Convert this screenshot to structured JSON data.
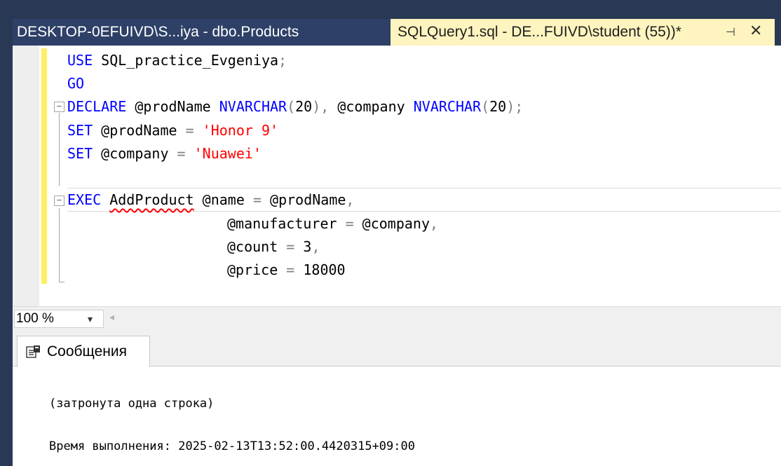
{
  "tabs": {
    "products_title": "DESKTOP-0EFUIVD\\S...iya - dbo.Products",
    "query_title": "SQLQuery1.sql - DE...FUIVD\\student (55))*",
    "pin_glyph": "⊣",
    "close_glyph": "✕"
  },
  "editor": {
    "fold_expanded_glyph": "−",
    "lines": {
      "l1_kw": "USE",
      "l1_rest": " SQL_practice_Evgeniya",
      "l1_semi": ";",
      "l2_kw": "GO",
      "l3_kw1": "DECLARE",
      "l3_var1": " @prodName ",
      "l3_type1": "NVARCHAR",
      "l3_p1": "(",
      "l3_n1": "20",
      "l3_p2": "),",
      "l3_var2": " @company ",
      "l3_type2": "NVARCHAR",
      "l3_p3": "(",
      "l3_n2": "20",
      "l3_p4": ");",
      "l4_kw": "SET",
      "l4_var": " @prodName ",
      "l4_eq": "=",
      "l4_str": " 'Honor 9'",
      "l5_kw": "SET",
      "l5_var": " @company ",
      "l5_eq": "=",
      "l5_str": " 'Nuawei'",
      "l7_kw": "EXEC",
      "l7_proc": "AddProduct",
      "l7_param": " @name ",
      "l7_eq": "=",
      "l7_val": " @prodName",
      "l7_comma": ",",
      "l8_param": "@manufacturer ",
      "l8_eq": "=",
      "l8_val": " @company",
      "l8_comma": ",",
      "l9_param": "@count ",
      "l9_eq": "=",
      "l9_val": " 3",
      "l9_comma": ",",
      "l10_param": "@price ",
      "l10_eq": "=",
      "l10_val": " 18000"
    }
  },
  "zoom": {
    "value": "100 %",
    "arrow": "▾",
    "scroll_left": "◂"
  },
  "messages": {
    "tab_label": "Сообщения",
    "line1": "(затронута одна строка)",
    "line2": "Время выполнения: 2025-02-13T13:52:00.4420315+09:00"
  },
  "colors": {
    "keyword": "#0000ff",
    "string": "#ff0000",
    "operator": "#808080",
    "active_tab": "#fdf4bf",
    "tabbar": "#293955"
  }
}
